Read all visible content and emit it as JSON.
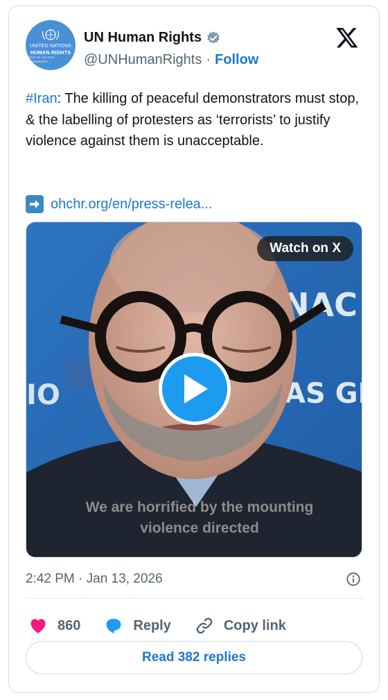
{
  "account": {
    "display_name": "UN Human Rights",
    "handle": "@UNHumanRights",
    "separator": "·",
    "follow_label": "Follow",
    "avatar_line1": "UNITED NATIONS",
    "avatar_line2": "HUMAN RIGHTS",
    "avatar_line3": "OFFICE OF THE HIGH COMMISSIONER",
    "avatar_color": "#4a90d6"
  },
  "tweet": {
    "hashtag": "#Iran",
    "body": ": The killing of peaceful demonstrators must stop, & the labelling of protesters as ‘terrorists’ to justify violence against them is unacceptable.",
    "link_text": "ohchr.org/en/press-relea..."
  },
  "media": {
    "watch_label": "Watch on X",
    "caption": "We are horrified by the mounting violence directed",
    "backdrop_text_1": "NAC",
    "backdrop_text_2": "AS GI",
    "backdrop_text_3": "IO"
  },
  "meta": {
    "timestamp": "2:42 PM · Jan 13, 2026"
  },
  "actions": {
    "likes": "860",
    "reply_label": "Reply",
    "copy_label": "Copy link"
  },
  "read_replies_label": "Read 382 replies",
  "colors": {
    "link": "#1d77d2",
    "like": "#f91880",
    "play": "#1d9bf0",
    "border": "#cfd9de"
  }
}
